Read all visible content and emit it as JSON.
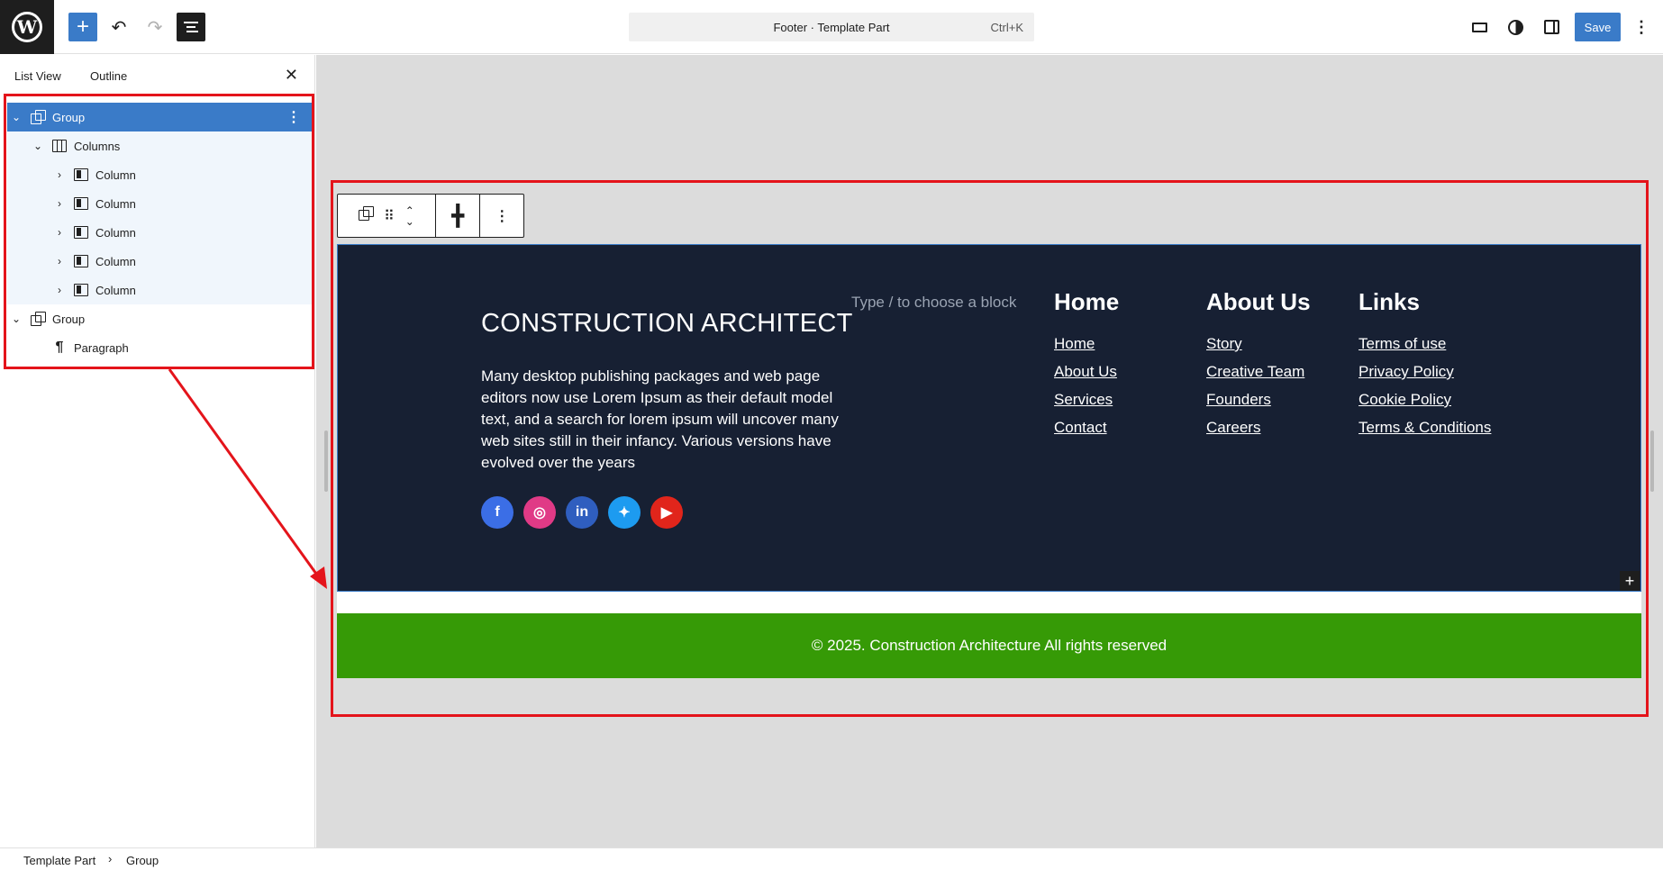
{
  "header": {
    "command_bar": {
      "title": "Footer · Template Part",
      "shortcut": "Ctrl+K"
    },
    "save_label": "Save",
    "add_icon": "plus-icon",
    "undo_icon": "undo-icon",
    "redo_icon": "redo-icon",
    "document_overview_icon": "list-view-icon",
    "view_icon": "desktop-icon",
    "styles_icon": "half-circle-icon",
    "settings_icon": "sidebar-panel-icon",
    "more_icon": "vertical-ellipsis-icon"
  },
  "sidebar": {
    "tabs": [
      "List View",
      "Outline"
    ],
    "close_icon": "close-icon",
    "tree": [
      {
        "label": "Group",
        "icon": "group-icon",
        "state": "expanded",
        "selected": true
      },
      {
        "label": "Columns",
        "icon": "columns-icon",
        "state": "expanded"
      },
      {
        "label": "Column",
        "icon": "column-icon",
        "state": "collapsed"
      },
      {
        "label": "Column",
        "icon": "column-icon",
        "state": "collapsed"
      },
      {
        "label": "Column",
        "icon": "column-icon",
        "state": "collapsed"
      },
      {
        "label": "Column",
        "icon": "column-icon",
        "state": "collapsed"
      },
      {
        "label": "Column",
        "icon": "column-icon",
        "state": "collapsed"
      },
      {
        "label": "Group",
        "icon": "group-icon",
        "state": "expanded"
      },
      {
        "label": "Paragraph",
        "icon": "paragraph-icon",
        "state": "none"
      }
    ]
  },
  "canvas": {
    "block_toolbar": {
      "icons": [
        "group-icon",
        "drag-handle-icon",
        "move-arrows-icon",
        "justify-icon",
        "vertical-ellipsis-icon"
      ]
    },
    "footer": {
      "site_title": "CONSTRUCTION ARCHITECT",
      "description": "Many desktop publishing packages and web page editors now use Lorem Ipsum as their default model text, and a search for lorem ipsum will uncover many web sites still in their infancy. Various versions have evolved over the years",
      "placeholder": "Type / to choose a block",
      "columns": [
        {
          "heading": "Home",
          "links": [
            "Home",
            "About Us",
            "Services",
            "Contact"
          ]
        },
        {
          "heading": "About Us",
          "links": [
            "Story",
            "Creative Team",
            "Founders",
            "Careers"
          ]
        },
        {
          "heading": "Links",
          "links": [
            "Terms of use",
            "Privacy Policy",
            "Cookie Policy",
            "Terms & Conditions"
          ]
        }
      ],
      "social_icons": [
        "facebook-icon",
        "instagram-icon",
        "linkedin-icon",
        "twitter-icon",
        "youtube-icon"
      ],
      "copyright": "© 2025. Construction Architecture All rights reserved"
    },
    "add_block_icon": "plus-icon"
  },
  "breadcrumb": [
    "Template Part",
    "Group"
  ],
  "colors": {
    "accent": "#3a7bc8",
    "footer_background": "#172033",
    "copyright_background": "#369a06",
    "annotation": "#e4141b"
  }
}
